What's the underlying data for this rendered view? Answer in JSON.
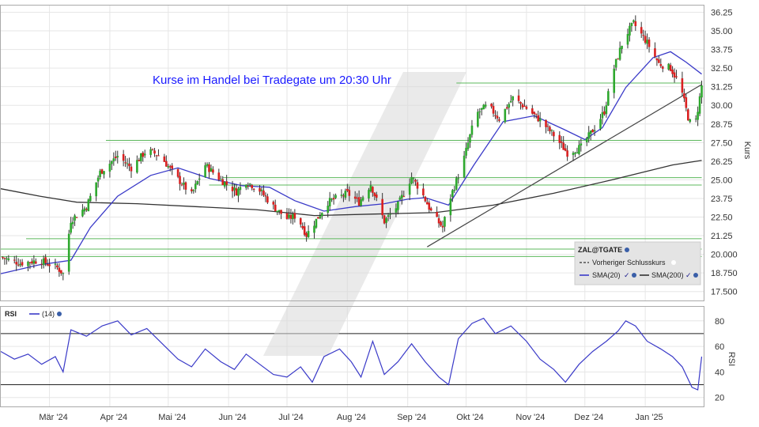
{
  "chart_data": [
    {
      "type": "candlestick",
      "annotation": "Kurse im Handel bei Tradegate um 20:30 Uhr",
      "ylabel": "Kurs",
      "ylim": [
        16.9,
        36.7
      ],
      "y_ticks": [
        "36.25",
        "35.00",
        "33.75",
        "32.50",
        "31.25",
        "30.00",
        "28.75",
        "27.50",
        "26.25",
        "25.00",
        "23.75",
        "22.50",
        "21.25",
        "20.000",
        "18.750",
        "17.500"
      ],
      "x_ticks": [
        "Mär '24",
        "Apr '24",
        "Mai '24",
        "Jun '24",
        "Jul '24",
        "Aug '24",
        "Sep '24",
        "Okt '24",
        "Nov '24",
        "Dez '24",
        "Jan '25"
      ],
      "x_tick_dates": [
        "2024-03-01",
        "2024-04-01",
        "2024-05-01",
        "2024-06-01",
        "2024-07-01",
        "2024-08-01",
        "2024-09-01",
        "2024-10-01",
        "2024-11-01",
        "2024-12-01",
        "2025-01-01"
      ],
      "x_range": [
        "2024-02-05",
        "2025-01-31"
      ],
      "grid": true,
      "legend": {
        "title": "ZAL@TGATE",
        "items": [
          "Vorheriger Schlusskurs",
          "SMA(20)",
          "SMA(200)"
        ],
        "placement": "bottom-right"
      },
      "colors": {
        "up": "#2ea82e",
        "down": "#d92020",
        "sma20": "#3a3ac8",
        "sma200": "#333333",
        "support": "#5cb85c",
        "trend": "#444444"
      },
      "horizontal_levels": [
        {
          "y": 31.5,
          "from": "2024-09-26",
          "to": "2025-01-30"
        },
        {
          "y": 27.65,
          "from": "2024-03-30",
          "to": "2025-01-30"
        },
        {
          "y": 25.15,
          "from": "2024-05-29",
          "to": "2025-01-30"
        },
        {
          "y": 24.65,
          "from": "2024-05-22",
          "to": "2025-01-30"
        },
        {
          "y": 21.05,
          "from": "2024-02-18",
          "to": "2025-01-30"
        },
        {
          "y": 20.35,
          "from": "2024-02-05",
          "to": "2025-01-30"
        },
        {
          "y": 19.85,
          "from": "2024-02-05",
          "to": "2025-01-30"
        }
      ],
      "trendline": {
        "from": [
          "2024-09-11",
          20.5
        ],
        "to": [
          "2025-01-30",
          31.4
        ]
      },
      "price_path": [
        [
          "2024-02-05",
          19.8
        ],
        [
          "2024-02-15",
          19.4
        ],
        [
          "2024-02-25",
          19.6
        ],
        [
          "2024-03-05",
          19.1
        ],
        [
          "2024-03-08",
          18.7
        ],
        [
          "2024-03-12",
          22.3
        ],
        [
          "2024-03-20",
          23.2
        ],
        [
          "2024-03-27",
          25.5
        ],
        [
          "2024-04-05",
          26.6
        ],
        [
          "2024-04-12",
          25.8
        ],
        [
          "2024-04-20",
          27.0
        ],
        [
          "2024-04-27",
          26.6
        ],
        [
          "2024-05-05",
          25.2
        ],
        [
          "2024-05-13",
          24.0
        ],
        [
          "2024-05-20",
          26.0
        ],
        [
          "2024-05-28",
          25.0
        ],
        [
          "2024-06-05",
          24.2
        ],
        [
          "2024-06-10",
          24.9
        ],
        [
          "2024-06-17",
          24.3
        ],
        [
          "2024-06-24",
          23.2
        ],
        [
          "2024-07-01",
          22.4
        ],
        [
          "2024-07-06",
          22.6
        ],
        [
          "2024-07-11",
          21.3
        ],
        [
          "2024-07-15",
          22.1
        ],
        [
          "2024-07-22",
          23.5
        ],
        [
          "2024-08-01",
          24.1
        ],
        [
          "2024-08-07",
          23.5
        ],
        [
          "2024-08-13",
          24.7
        ],
        [
          "2024-08-20",
          22.2
        ],
        [
          "2024-08-27",
          23.3
        ],
        [
          "2024-09-03",
          25.2
        ],
        [
          "2024-09-08",
          24.2
        ],
        [
          "2024-09-14",
          22.6
        ],
        [
          "2024-09-19",
          21.8
        ],
        [
          "2024-09-22",
          23.5
        ],
        [
          "2024-09-29",
          26.0
        ],
        [
          "2024-10-06",
          29.4
        ],
        [
          "2024-10-12",
          30.0
        ],
        [
          "2024-10-18",
          29.1
        ],
        [
          "2024-10-25",
          30.5
        ],
        [
          "2024-11-01",
          29.8
        ],
        [
          "2024-11-08",
          29.0
        ],
        [
          "2024-11-15",
          28.0
        ],
        [
          "2024-11-22",
          26.8
        ],
        [
          "2024-11-29",
          27.2
        ],
        [
          "2024-12-06",
          28.5
        ],
        [
          "2024-12-11",
          29.6
        ],
        [
          "2024-12-16",
          32.5
        ],
        [
          "2024-12-21",
          34.5
        ],
        [
          "2024-12-26",
          35.5
        ],
        [
          "2025-01-02",
          34.2
        ],
        [
          "2025-01-08",
          32.8
        ],
        [
          "2025-01-14",
          32.5
        ],
        [
          "2025-01-19",
          31.3
        ],
        [
          "2025-01-23",
          29.2
        ],
        [
          "2025-01-26",
          28.2
        ],
        [
          "2025-01-30",
          31.3
        ]
      ],
      "sma20_path": [
        [
          "2024-02-05",
          18.7
        ],
        [
          "2024-02-25",
          19.3
        ],
        [
          "2024-03-12",
          19.6
        ],
        [
          "2024-03-22",
          21.8
        ],
        [
          "2024-04-05",
          23.9
        ],
        [
          "2024-04-22",
          25.3
        ],
        [
          "2024-05-06",
          25.8
        ],
        [
          "2024-05-22",
          25.1
        ],
        [
          "2024-06-08",
          24.6
        ],
        [
          "2024-06-22",
          24.5
        ],
        [
          "2024-07-05",
          23.6
        ],
        [
          "2024-07-20",
          22.9
        ],
        [
          "2024-08-05",
          23.2
        ],
        [
          "2024-08-20",
          23.4
        ],
        [
          "2024-09-01",
          23.7
        ],
        [
          "2024-09-10",
          23.8
        ],
        [
          "2024-09-22",
          23.3
        ],
        [
          "2024-10-05",
          26.0
        ],
        [
          "2024-10-20",
          28.9
        ],
        [
          "2024-11-05",
          29.3
        ],
        [
          "2024-11-20",
          28.4
        ],
        [
          "2024-12-01",
          27.7
        ],
        [
          "2024-12-10",
          28.5
        ],
        [
          "2024-12-22",
          31.2
        ],
        [
          "2025-01-05",
          33.2
        ],
        [
          "2025-01-14",
          33.6
        ],
        [
          "2025-01-22",
          32.9
        ],
        [
          "2025-01-30",
          32.1
        ]
      ],
      "sma200_path": [
        [
          "2024-02-05",
          24.4
        ],
        [
          "2024-02-25",
          23.9
        ],
        [
          "2024-03-15",
          23.5
        ],
        [
          "2024-04-15",
          23.4
        ],
        [
          "2024-05-15",
          23.2
        ],
        [
          "2024-06-15",
          23.0
        ],
        [
          "2024-07-15",
          22.6
        ],
        [
          "2024-08-15",
          22.7
        ],
        [
          "2024-09-15",
          22.8
        ],
        [
          "2024-10-15",
          23.3
        ],
        [
          "2024-11-15",
          24.1
        ],
        [
          "2024-12-15",
          25.0
        ],
        [
          "2025-01-15",
          26.0
        ],
        [
          "2025-01-30",
          26.3
        ]
      ]
    },
    {
      "type": "line",
      "name": "RSI",
      "legend_label": "(14)",
      "ylabel": "RSI",
      "ylim": [
        13,
        91
      ],
      "y_ticks": [
        "80",
        "60",
        "40",
        "20"
      ],
      "reference_lines": [
        70,
        30
      ],
      "rsi_path": [
        [
          "2024-02-05",
          56
        ],
        [
          "2024-02-12",
          50
        ],
        [
          "2024-02-19",
          54
        ],
        [
          "2024-02-26",
          46
        ],
        [
          "2024-03-04",
          52
        ],
        [
          "2024-03-08",
          40
        ],
        [
          "2024-03-12",
          73
        ],
        [
          "2024-03-20",
          68
        ],
        [
          "2024-03-28",
          76
        ],
        [
          "2024-04-05",
          80
        ],
        [
          "2024-04-12",
          69
        ],
        [
          "2024-04-20",
          74
        ],
        [
          "2024-04-28",
          62
        ],
        [
          "2024-05-06",
          50
        ],
        [
          "2024-05-13",
          44
        ],
        [
          "2024-05-20",
          58
        ],
        [
          "2024-05-28",
          48
        ],
        [
          "2024-06-04",
          42
        ],
        [
          "2024-06-10",
          54
        ],
        [
          "2024-06-17",
          46
        ],
        [
          "2024-06-24",
          38
        ],
        [
          "2024-07-01",
          36
        ],
        [
          "2024-07-08",
          44
        ],
        [
          "2024-07-14",
          32
        ],
        [
          "2024-07-20",
          52
        ],
        [
          "2024-07-28",
          58
        ],
        [
          "2024-08-03",
          48
        ],
        [
          "2024-08-08",
          36
        ],
        [
          "2024-08-14",
          64
        ],
        [
          "2024-08-20",
          38
        ],
        [
          "2024-08-27",
          48
        ],
        [
          "2024-09-03",
          62
        ],
        [
          "2024-09-10",
          48
        ],
        [
          "2024-09-17",
          36
        ],
        [
          "2024-09-22",
          30
        ],
        [
          "2024-09-27",
          66
        ],
        [
          "2024-10-04",
          78
        ],
        [
          "2024-10-10",
          82
        ],
        [
          "2024-10-16",
          70
        ],
        [
          "2024-10-24",
          76
        ],
        [
          "2024-11-01",
          64
        ],
        [
          "2024-11-08",
          50
        ],
        [
          "2024-11-15",
          42
        ],
        [
          "2024-11-21",
          32
        ],
        [
          "2024-11-28",
          46
        ],
        [
          "2024-12-05",
          56
        ],
        [
          "2024-12-12",
          64
        ],
        [
          "2024-12-18",
          72
        ],
        [
          "2024-12-22",
          80
        ],
        [
          "2024-12-27",
          76
        ],
        [
          "2025-01-02",
          64
        ],
        [
          "2025-01-09",
          58
        ],
        [
          "2025-01-15",
          52
        ],
        [
          "2025-01-20",
          44
        ],
        [
          "2025-01-25",
          28
        ],
        [
          "2025-01-28",
          26
        ],
        [
          "2025-01-30",
          52
        ]
      ]
    }
  ]
}
